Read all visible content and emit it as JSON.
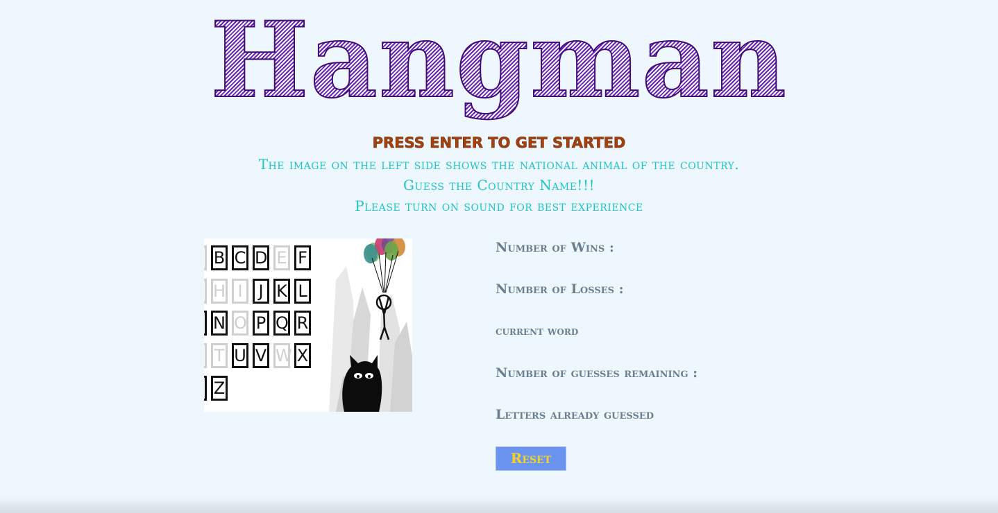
{
  "title": "Hangman",
  "prompt": "press enter to get started",
  "instructions": {
    "line1": "The image on the left side shows the national animal of the country.",
    "line2": "Guess the Country Name!!!",
    "line3": "Please turn on sound for best experience"
  },
  "picture": {
    "tiles": [
      {
        "letter": "B",
        "dim": false
      },
      {
        "letter": "C",
        "dim": false
      },
      {
        "letter": "D",
        "dim": false
      },
      {
        "letter": "E",
        "dim": true
      },
      {
        "letter": "F",
        "dim": false
      },
      {
        "letter": "H",
        "dim": true
      },
      {
        "letter": "I",
        "dim": true
      },
      {
        "letter": "J",
        "dim": false
      },
      {
        "letter": "K",
        "dim": false
      },
      {
        "letter": "L",
        "dim": false
      },
      {
        "letter": "N",
        "dim": false
      },
      {
        "letter": "O",
        "dim": true
      },
      {
        "letter": "P",
        "dim": false
      },
      {
        "letter": "Q",
        "dim": false
      },
      {
        "letter": "R",
        "dim": false
      },
      {
        "letter": "T",
        "dim": true
      },
      {
        "letter": "U",
        "dim": false
      },
      {
        "letter": "V",
        "dim": false
      },
      {
        "letter": "W",
        "dim": true
      },
      {
        "letter": "X",
        "dim": false
      },
      {
        "letter": "Z",
        "dim": false
      }
    ],
    "balloon_colors": [
      "#7fbf7a",
      "#c83e6f",
      "#7b4a8f",
      "#d38a3a",
      "#3f8f8f",
      "#6ea64c"
    ]
  },
  "stats": {
    "wins_label": "Number of Wins :",
    "losses_label": "Number of Losses :",
    "current_word_label": "current word",
    "guesses_label": "Number of guesses remaining :",
    "letters_label": "Letters already guessed"
  },
  "reset_label": "Reset",
  "colors": {
    "background": "#eef7fe",
    "title": "#5b1b9c",
    "prompt": "#a4410f",
    "instructions": "#20c4c4",
    "stats": "#6c7f8f",
    "reset_bg": "#6b93f0",
    "reset_text": "#f4d227"
  }
}
